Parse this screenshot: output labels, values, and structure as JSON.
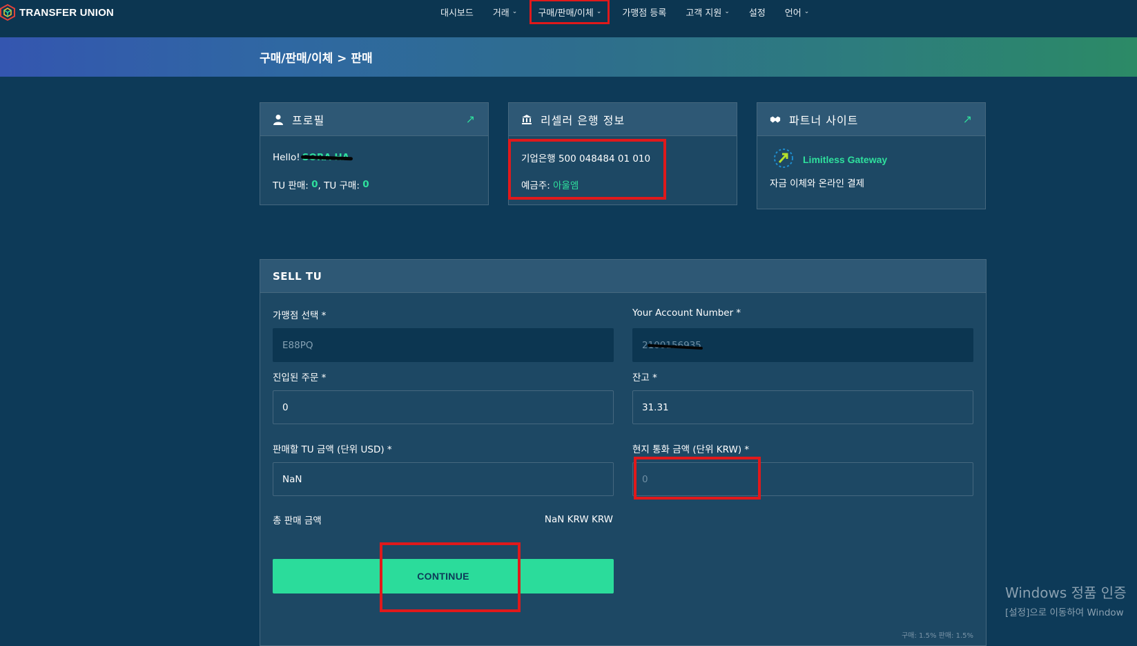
{
  "brand": {
    "name": "TRANSFER UNION",
    "logo_icon": "hexagon-cube-logo"
  },
  "nav": {
    "items": [
      {
        "label": "대시보드",
        "dropdown": false
      },
      {
        "label": "거래",
        "dropdown": true
      },
      {
        "label": "구매/판매/이체",
        "dropdown": true,
        "highlighted": true
      },
      {
        "label": "가맹점 등록",
        "dropdown": false
      },
      {
        "label": "고객 지원",
        "dropdown": true
      },
      {
        "label": "설정",
        "dropdown": false
      },
      {
        "label": "언어",
        "dropdown": true
      }
    ]
  },
  "breadcrumb": "구매/판매/이체 > 판매",
  "profile_card": {
    "title": "프로필",
    "hello": "Hello!",
    "name_redacted": "SORA HA",
    "sell_label": "TU 판매:",
    "sell_value": "0",
    "buy_label": ", TU 구매:",
    "buy_value": "0"
  },
  "bank_card": {
    "title": "리셀러 은행 정보",
    "bank_line": "기업은행 500 048484 01 010",
    "holder_label": "예금주:",
    "holder_value": "아울엠"
  },
  "partner_card": {
    "title": "파트너 사이트",
    "partner_name": "Limitless Gateway",
    "description": "자금 이체와 온라인 결제"
  },
  "sell_form": {
    "title": "SELL TU",
    "merchant_label": "가맹점 선택 *",
    "merchant_value": "E88PQ",
    "account_label": "Your Account Number *",
    "account_value": "2100156935",
    "order_label": "진입된 주문 *",
    "order_value": "0",
    "balance_label": "잔고 *",
    "balance_value": "31.31",
    "tu_amount_label": "판매할 TU 금액 (단위 USD) *",
    "tu_amount_value": "NaN",
    "local_amount_label": "현지 통화 금액 (단위 KRW) *",
    "local_amount_placeholder": "0",
    "total_label": "총 판매 금액",
    "total_value": "NaN KRW KRW",
    "continue_label": "CONTINUE",
    "rates": "구매: 1.5% 판매: 1.5%"
  },
  "watermark": {
    "title": "Windows 정품 인증",
    "subtitle": "[설정]으로 이동하여 Window"
  },
  "colors": {
    "background": "#0d3a58",
    "accent_green": "#2bdc9b",
    "highlight_red": "#e0191b"
  }
}
